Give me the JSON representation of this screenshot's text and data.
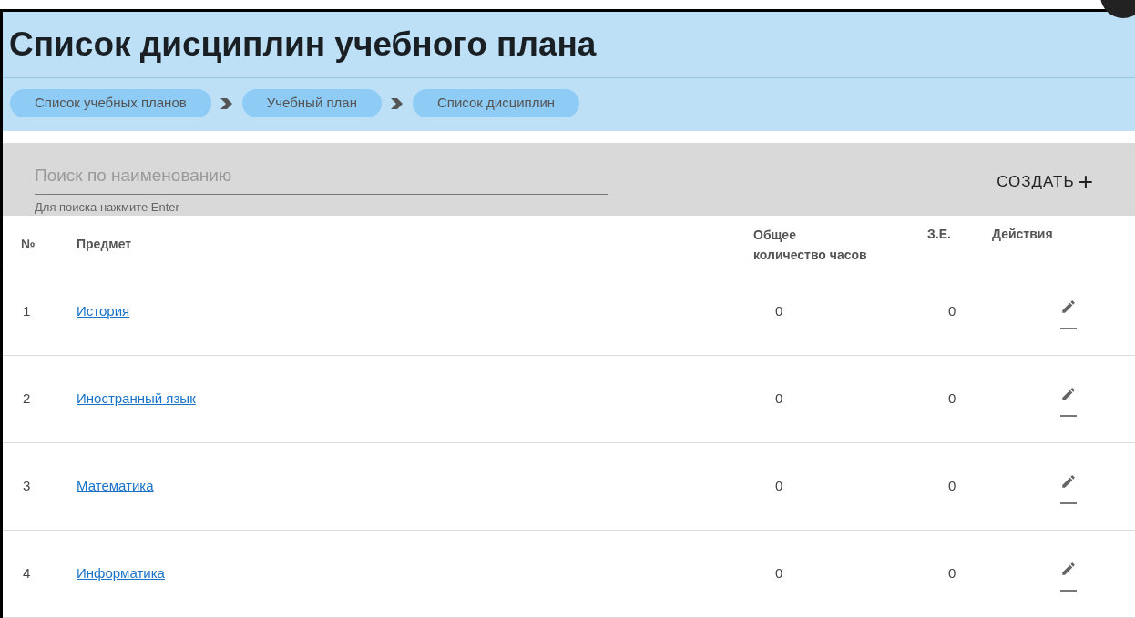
{
  "title": "Список дисциплин учебного плана",
  "breadcrumbs": [
    "Список учебных планов",
    "Учебный план",
    "Список дисциплин"
  ],
  "search": {
    "placeholder": "Поиск по наименованию",
    "hint": "Для поиска нажмите Enter"
  },
  "create_button": {
    "label": "СОЗДАТЬ",
    "icon": "+"
  },
  "table": {
    "columns": [
      "№",
      "Предмет",
      "Общее количество часов",
      "З.Е.",
      "Действия"
    ],
    "rows": [
      {
        "number": "1",
        "subject": "История",
        "hours": "0",
        "credits": "0"
      },
      {
        "number": "2",
        "subject": "Иностранный язык",
        "hours": "0",
        "credits": "0"
      },
      {
        "number": "3",
        "subject": "Математика",
        "hours": "0",
        "credits": "0"
      },
      {
        "number": "4",
        "subject": "Информатика",
        "hours": "0",
        "credits": "0"
      }
    ]
  }
}
